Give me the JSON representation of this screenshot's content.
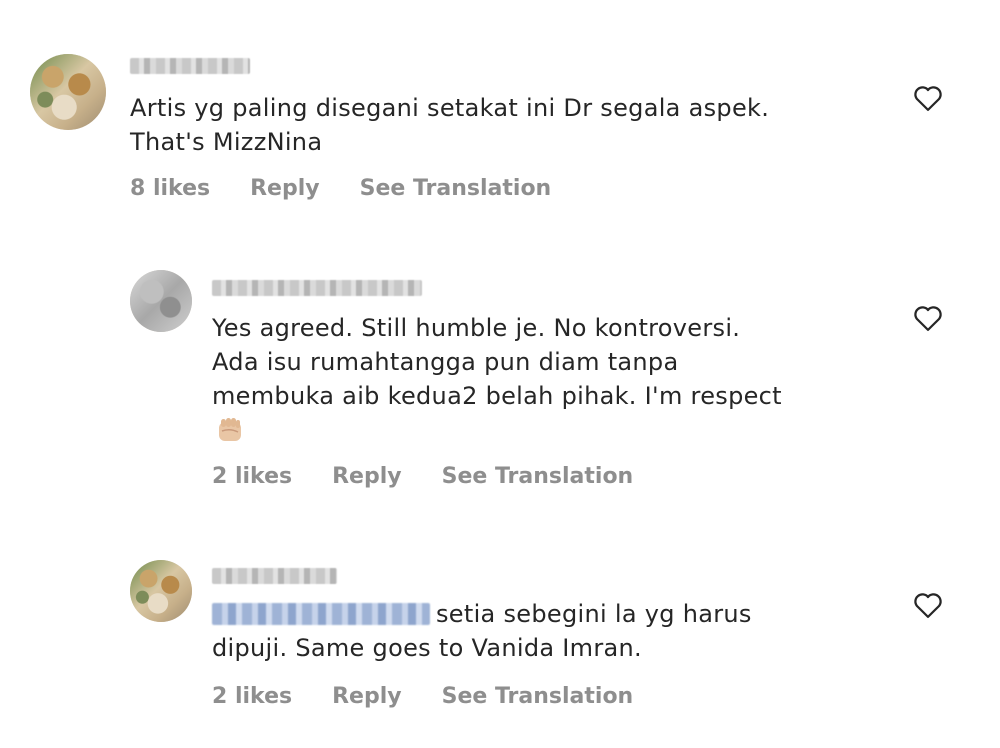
{
  "comments": [
    {
      "text_lines": [
        "Artis yg paling disegani setakat ini Dr segala aspek.",
        "That's MizzNina"
      ],
      "likes": "8 likes",
      "reply": "Reply",
      "translate": "See Translation"
    },
    {
      "text_lines": [
        "Yes agreed. Still humble je. No kontroversi.",
        "Ada isu rumahtangga pun diam tanpa",
        "membuka aib kedua2 belah pihak. I'm respect"
      ],
      "emoji": "fist-emoji",
      "likes": "2 likes",
      "reply": "Reply",
      "translate": "See Translation"
    },
    {
      "text_lines": [
        "setia sebegini la yg harus",
        "dipuji. Same goes to Vanida Imran."
      ],
      "likes": "2 likes",
      "reply": "Reply",
      "translate": "See Translation"
    }
  ],
  "icons": {
    "like": "heart-outline-icon"
  }
}
